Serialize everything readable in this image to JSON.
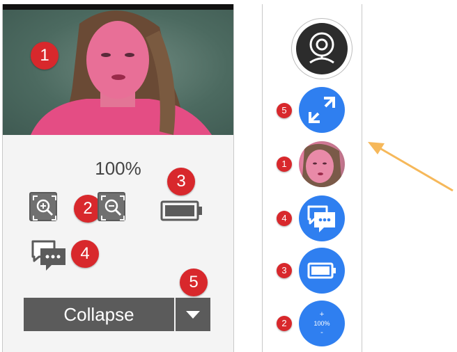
{
  "colors": {
    "badge_red": "#d8282c",
    "action_blue": "#2f7ff0",
    "control_gray": "#5b5b5b",
    "arrow_orange": "#f6b85a",
    "video_tint": "#e8578a"
  },
  "expanded_panel": {
    "video_badge": "1",
    "zoom_percent": "100%",
    "zoom_controls_badge": "2",
    "battery_badge": "3",
    "chat_badge": "4",
    "collapse_badge": "5",
    "collapse_label": "Collapse",
    "icons": {
      "zoom_in": "zoom-in-icon",
      "zoom_out": "zoom-out-icon",
      "battery": "battery-icon",
      "chat": "chat-icon",
      "dropdown": "caret-down-icon"
    }
  },
  "collapsed_panel": {
    "webcam_icon": "webcam-icon",
    "expand_badge": "5",
    "video_thumb_badge": "1",
    "chat_badge": "4",
    "battery_badge": "3",
    "zoom_badge": "2",
    "zoom_plus": "+",
    "zoom_value": "100%",
    "zoom_minus": "-"
  }
}
